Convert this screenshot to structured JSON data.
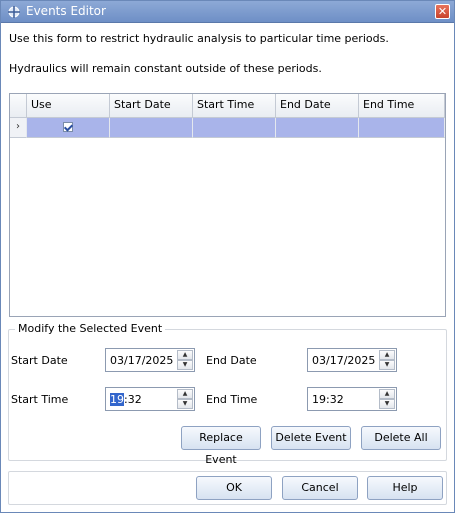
{
  "window": {
    "title": "Events Editor",
    "close_glyph": "✕"
  },
  "intro": {
    "line1": "Use this form to restrict hydraulic analysis to particular time periods.",
    "line2": "Hydraulics will remain constant outside of these periods."
  },
  "grid": {
    "columns": [
      "Use",
      "Start Date",
      "Start Time",
      "End Date",
      "End Time"
    ],
    "row_pointer": "›",
    "rows": [
      {
        "use": true,
        "start_date": "",
        "start_time": "",
        "end_date": "",
        "end_time": ""
      }
    ]
  },
  "modify": {
    "title": "Modify the Selected Event",
    "start_date_label": "Start Date",
    "start_date_value": "03/17/2025",
    "end_date_label": "End Date",
    "end_date_value": "03/17/2025",
    "start_time_label": "Start Time",
    "start_time_hour": "19",
    "start_time_rest": ":32",
    "end_time_label": "End Time",
    "end_time_value": "19:32",
    "spin_up": "▲",
    "spin_down": "▼"
  },
  "buttons": {
    "replace": "Replace Event",
    "delete": "Delete Event",
    "delete_all": "Delete All",
    "ok": "OK",
    "cancel": "Cancel",
    "help": "Help"
  },
  "colors": {
    "selection": "#a9b4ea",
    "titlebar": "#7b9bd0"
  }
}
